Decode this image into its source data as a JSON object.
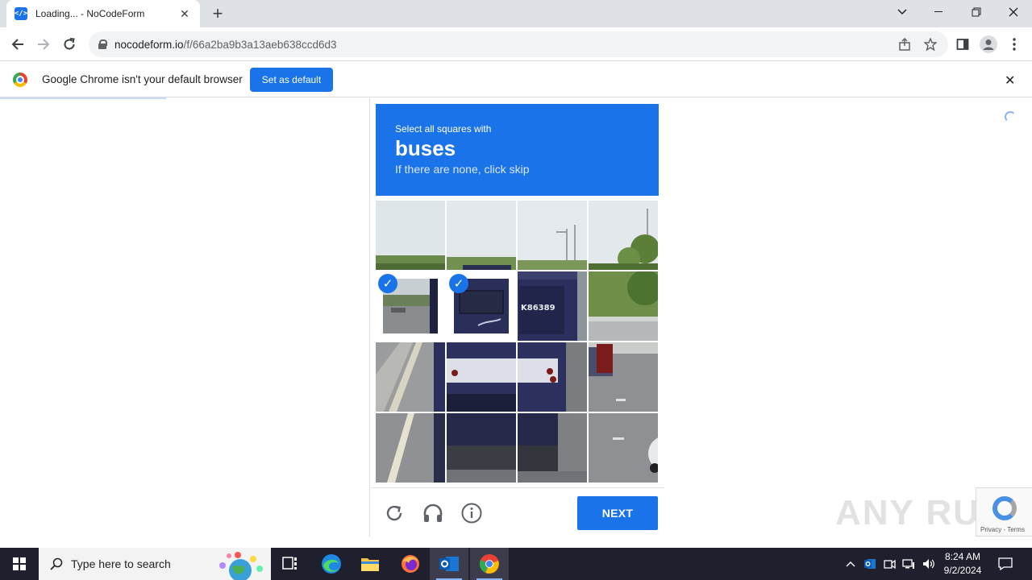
{
  "browser": {
    "tab_title": "Loading... - NoCodeForm",
    "url_host": "nocodeform.io",
    "url_path": "/f/66a2ba9b3a13aeb638ccd6d3"
  },
  "infobar": {
    "message": "Google Chrome isn't your default browser",
    "set_default_label": "Set as default"
  },
  "captcha": {
    "instruction_line1": "Select all squares with",
    "target": "buses",
    "instruction_line3": "If there are none, click skip",
    "tile_id_text": "K86389",
    "next_label": "NEXT",
    "recaptcha_links": "Privacy - Terms"
  },
  "watermark": "ANY RUN",
  "taskbar": {
    "search_placeholder": "Type here to search",
    "time": "8:24 AM",
    "date": "9/2/2024"
  },
  "colors": {
    "accent": "#1a73e8",
    "taskbar": "#1f1f2e"
  }
}
